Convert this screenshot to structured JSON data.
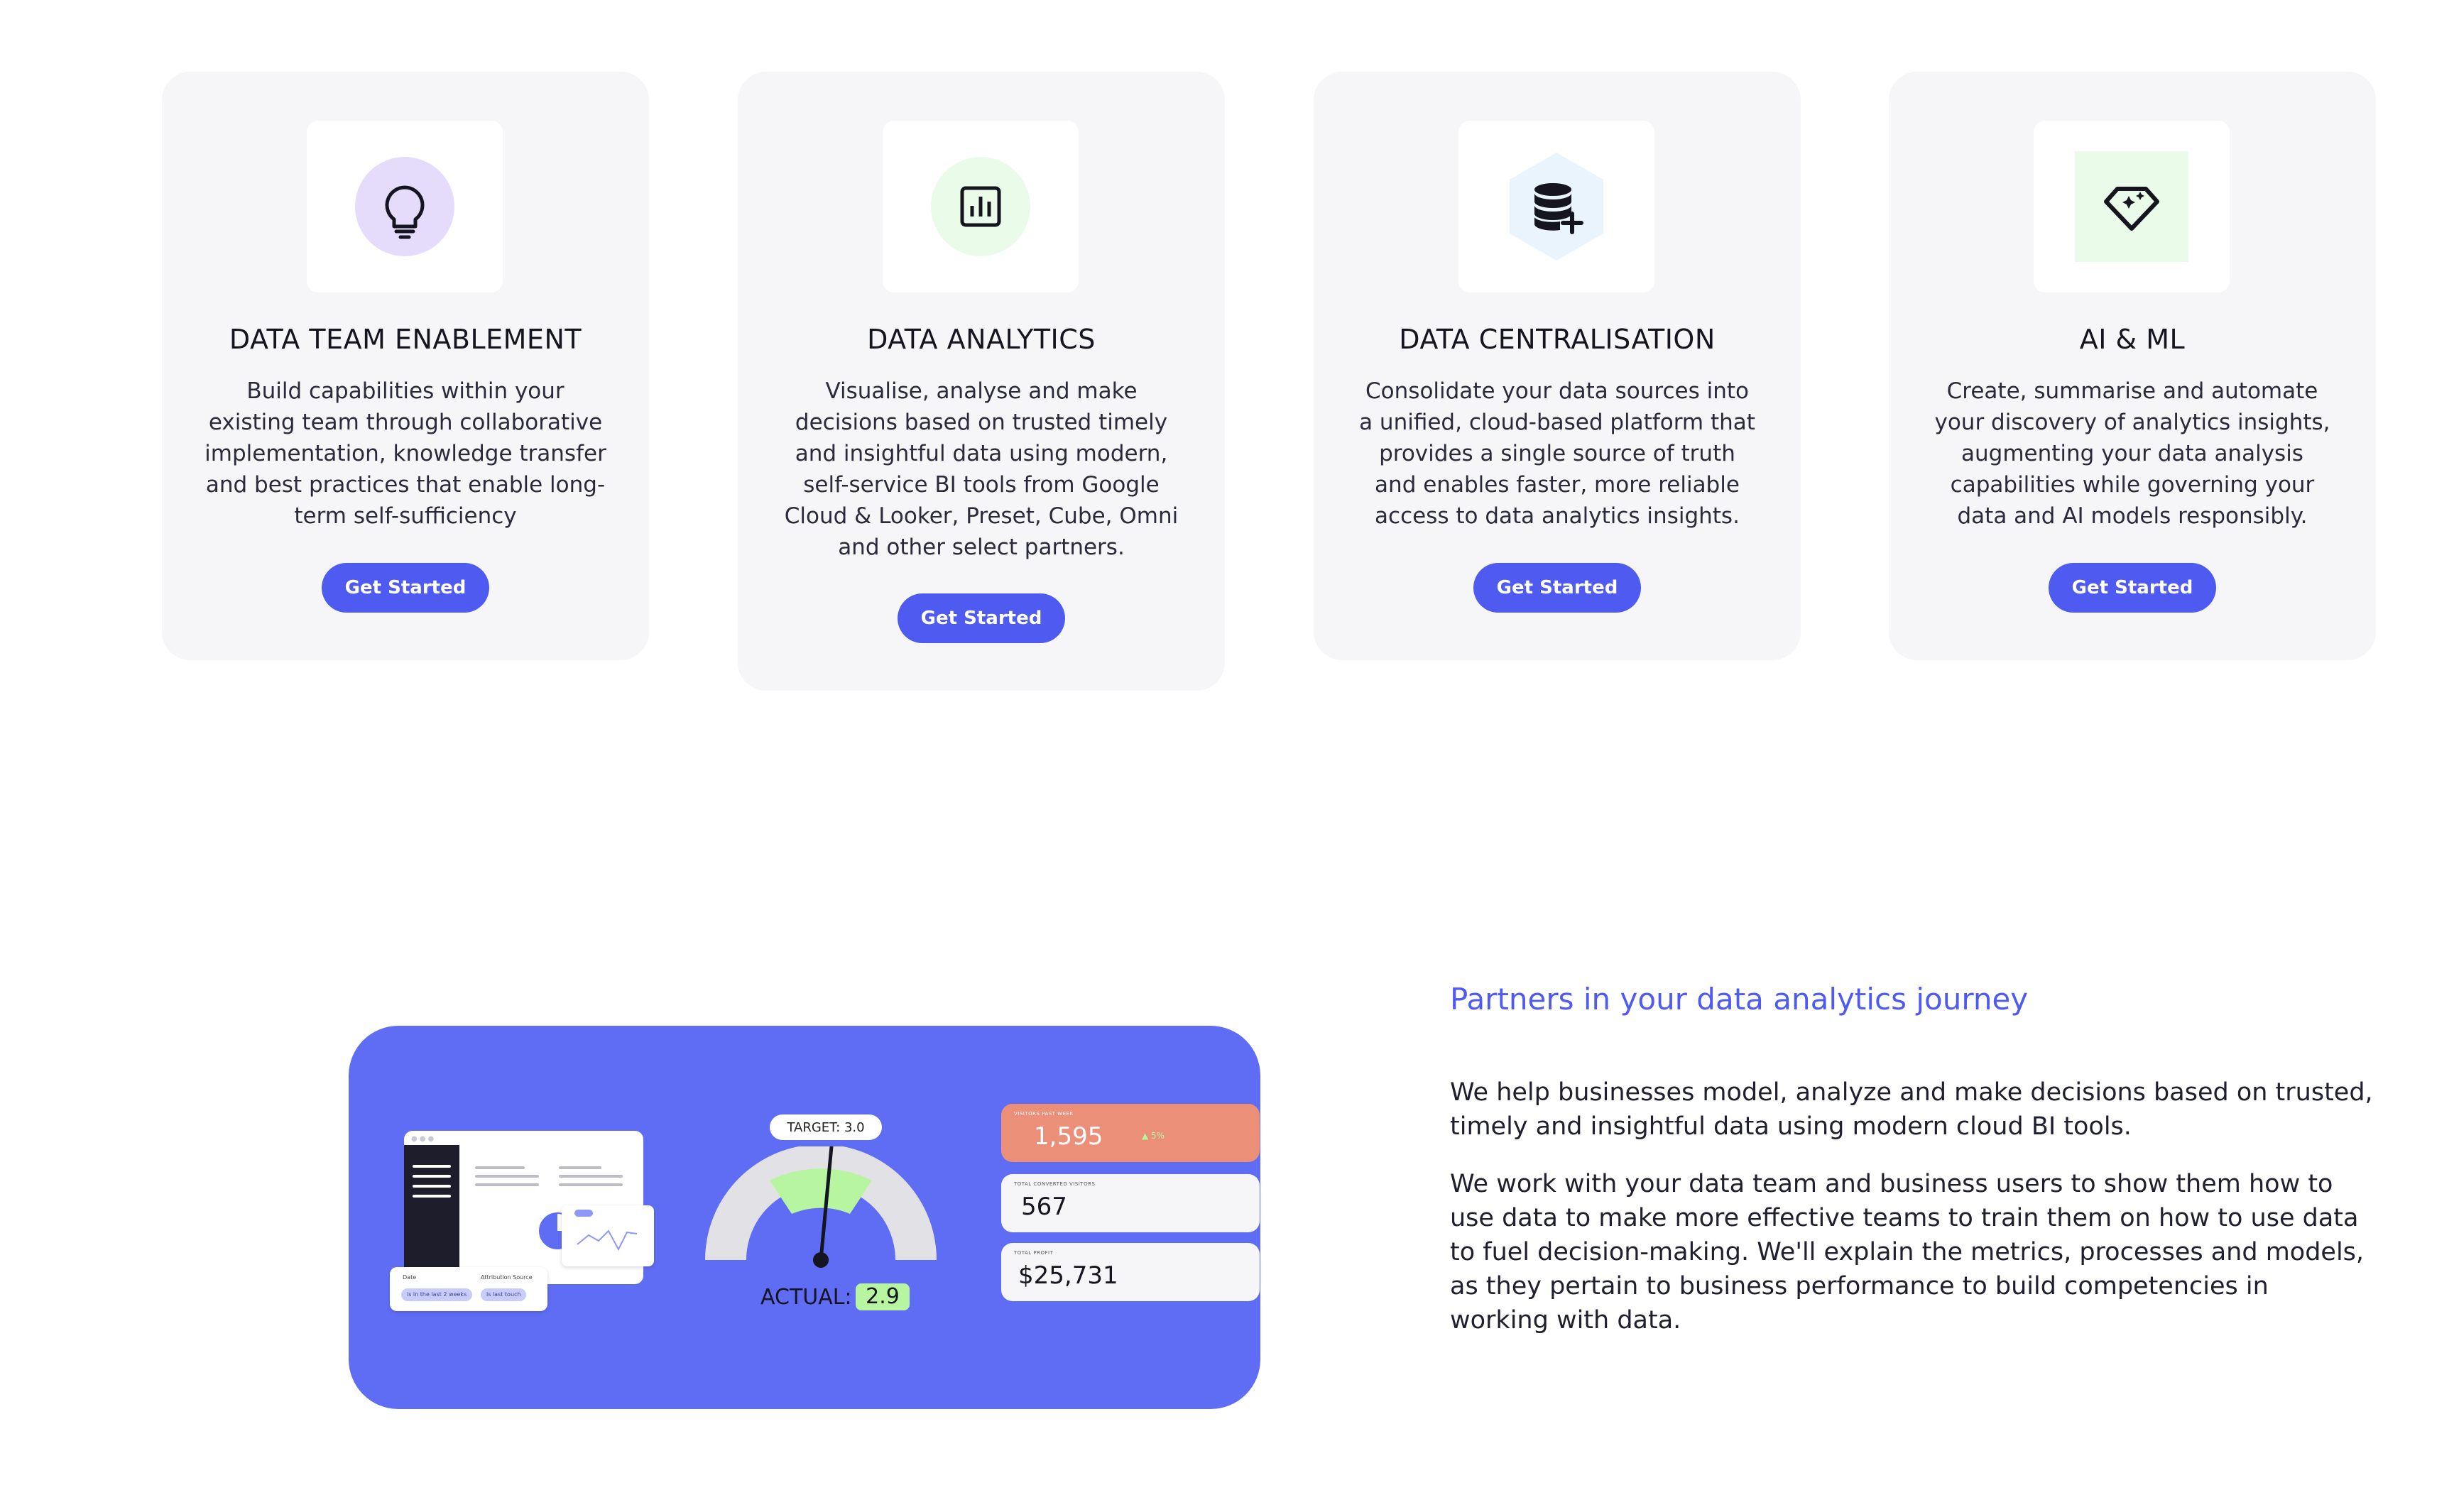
{
  "cards": [
    {
      "title": "DATA TEAM ENABLEMENT",
      "description": "Build capabilities within your existing team through collaborative implementation, knowledge transfer and best practices that enable long-term self-sufficiency",
      "button": "Get Started",
      "icon": "lightbulb-icon",
      "icon_bg": "#e5dcfb"
    },
    {
      "title": "DATA ANALYTICS",
      "description": "Visualise, analyse and make decisions based on trusted timely and insightful data using modern, self-service BI tools from Google Cloud & Looker, Preset, Cube, Omni and other select partners.",
      "button": "Get Started",
      "icon": "bar-chart-icon",
      "icon_bg": "#ebfbe9"
    },
    {
      "title": "DATA CENTRALISATION",
      "description": "Consolidate your data sources into a unified, cloud-based platform that provides a single source of truth and enables faster, more reliable access to data analytics insights.",
      "button": "Get Started",
      "icon": "database-plus-icon",
      "icon_bg": "#e9f4fd"
    },
    {
      "title": "AI & ML",
      "description": "Create, summarise and automate your discovery of analytics insights, augmenting your data analysis capabilities while governing your data and AI models responsibly.",
      "button": "Get Started",
      "icon": "diamond-sparkle-icon",
      "icon_bg": "#ebfbe9"
    }
  ],
  "partners": {
    "heading": "Partners in your data analytics journey",
    "paragraph1": "We help businesses model, analyze and make decisions based on trusted, timely and insightful data using modern cloud BI tools.",
    "paragraph2": "We work with your data team and business users to show them how to use data to make more effective teams to train them on how to use data to fuel decision-making. We'll explain the metrics, processes and models, as they pertain to business performance to build competencies in working with data."
  },
  "illustration": {
    "target": "TARGET: 3.0",
    "actual_label": "ACTUAL:",
    "actual_value": "2.9",
    "filter_labels": [
      "Date",
      "Attribution Source"
    ],
    "filter_chips": [
      "is in the last 2 weeks",
      "is last touch"
    ],
    "kpis": [
      {
        "caption": "VISITORS PAST WEEK",
        "value": "1,595",
        "delta": "▲ 5%"
      },
      {
        "caption": "TOTAL CONVERTED VISITORS",
        "value": "567"
      },
      {
        "caption": "TOTAL PROFIT",
        "value": "$25,731"
      }
    ],
    "colors": {
      "panel": "#5f6df5",
      "accent": "#4f5bf0",
      "gauge_target_zone": "#b7f5a0",
      "kpi_highlight": "#ec8f79"
    }
  }
}
